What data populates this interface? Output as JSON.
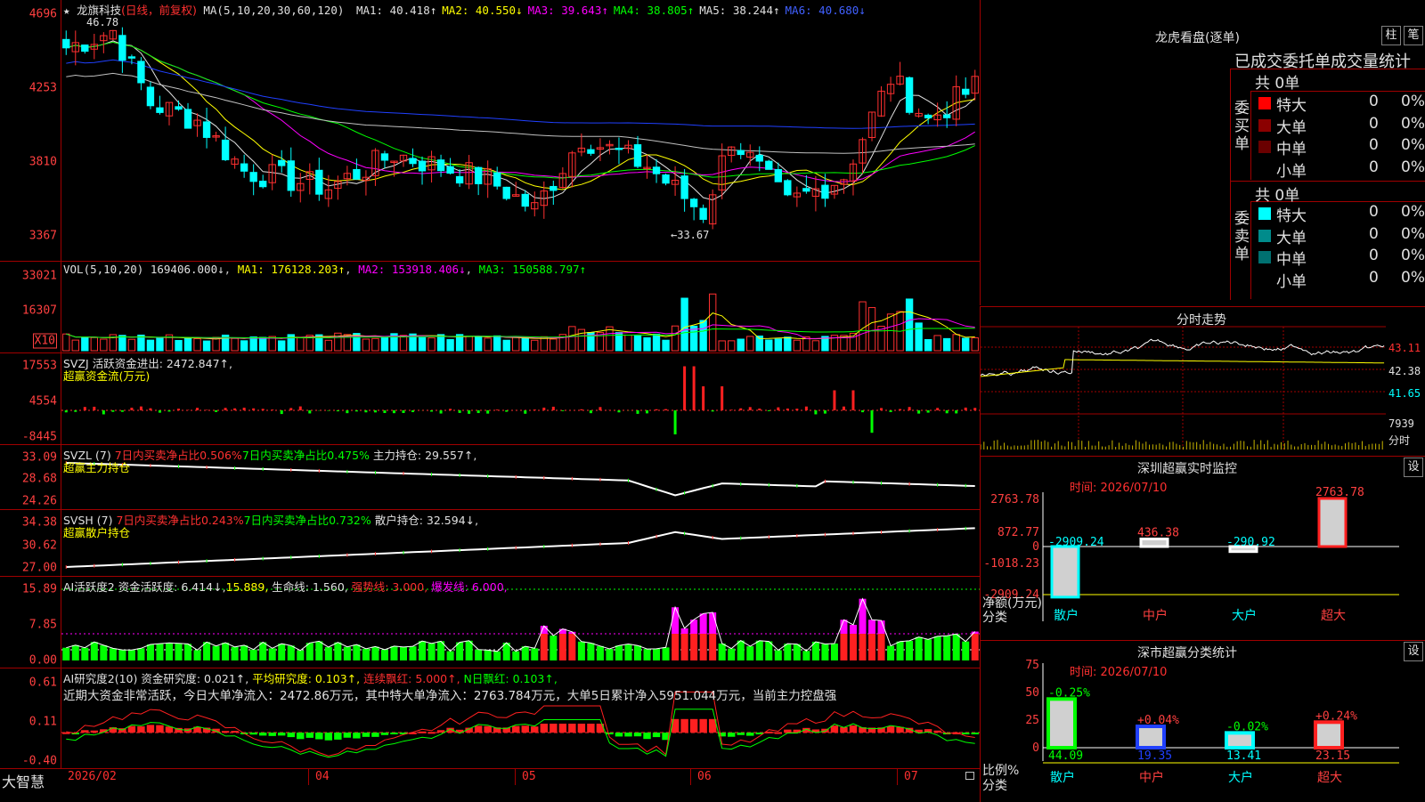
{
  "stock": {
    "name": "龙旗科技",
    "period": "(日线，前复权)",
    "star": "★"
  },
  "main": {
    "ma_title": "MA(5,10,20,30,60,120)",
    "ma": [
      {
        "t": "MA1: 40.418↑",
        "c": "#e0e0e0"
      },
      {
        "t": "MA2: 40.550↓",
        "c": "#ffff00"
      },
      {
        "t": "MA3: 39.643↑",
        "c": "#ff00ff"
      },
      {
        "t": "MA4: 38.805↑",
        "c": "#00ff00"
      },
      {
        "t": "MA5: 38.244↑",
        "c": "#e0e0e0"
      },
      {
        "t": "MA6: 40.680↓",
        "c": "#4060ff"
      }
    ],
    "yticks": [
      "4696",
      "4253",
      "3810",
      "3367"
    ],
    "high_label": "46.78",
    "low_label": "←33.67"
  },
  "vol": {
    "title": "VOL(5,10,20)",
    "v": "169406.000↓",
    "ma1": "MA1: 176128.203↑",
    "ma2": "MA2: 153918.406↓",
    "ma3": "MA3: 150588.797↑",
    "yticks": [
      "33021",
      "16307"
    ],
    "unit": "X10"
  },
  "svzj": {
    "title": "SVZJ  活跃资金进出: 2472.847↑,",
    "sub": "超赢资金流(万元)",
    "yticks": [
      "17553",
      "4554",
      "-8445"
    ]
  },
  "svzl": {
    "title": "SVZL (7)",
    "a": "7日内买卖净占比0.506%",
    "b": "7日内买卖净占比0.475%",
    "c": "主力持仓: 29.557↑,",
    "sub": "超赢主力持仓",
    "yticks": [
      "33.09",
      "28.68",
      "24.26"
    ]
  },
  "svsh": {
    "title": "SVSH (7)",
    "a": "7日内买卖净占比0.243%",
    "b": "7日内买卖净占比0.732%",
    "c": "散户持仓: 32.594↓,",
    "sub": "超赢散户持仓",
    "yticks": [
      "34.38",
      "30.62",
      "27.00"
    ]
  },
  "ai1": {
    "title": "AI活跃度2 资金活跃度: 6.414↓,",
    "v2": "15.889,",
    "life": "生命线: 1.560,",
    "strong": "强势线: 3.000,",
    "burst": "爆发线: 6.000,",
    "yticks": [
      "15.89",
      "7.85",
      "0.00"
    ]
  },
  "ai2": {
    "title": "AI研究度2(10) 资金研究度: 0.021↑,",
    "avg": "平均研究度: 0.103↑,",
    "lian": "连续飘红: 5.000↑,",
    "nday": "N日飘红: 0.103↑,",
    "comment": "近期大资金非常活跃，今日大单净流入：2472.86万元，其中特大单净流入：2763.784万元，大单5日累计净入5951.044万元，当前主力控盘强",
    "yticks": [
      "0.61",
      "0.11",
      "-0.40"
    ]
  },
  "xaxis": {
    "brand": "大智慧",
    "dates": [
      "2026/02",
      "04",
      "05",
      "06",
      "07"
    ]
  },
  "lhb": {
    "title": "龙虎看盘(逐单)",
    "btn_zhu": "柱",
    "btn_bi": "笔",
    "stats_title": "已成交委托单成交量统计",
    "buy": {
      "label": "委买单",
      "total": "共 0单",
      "rows": [
        {
          "n": "特大",
          "v": "0",
          "p": "0%",
          "c": "#ff0000"
        },
        {
          "n": "大单",
          "v": "0",
          "p": "0%",
          "c": "#8b0000"
        },
        {
          "n": "中单",
          "v": "0",
          "p": "0%",
          "c": "#6a0000"
        },
        {
          "n": "小单",
          "v": "0",
          "p": "0%",
          "c": "#000000"
        }
      ]
    },
    "sell": {
      "label": "委卖单",
      "total": "共 0单",
      "rows": [
        {
          "n": "特大",
          "v": "0",
          "p": "0%",
          "c": "#00ffff"
        },
        {
          "n": "大单",
          "v": "0",
          "p": "0%",
          "c": "#008b8b"
        },
        {
          "n": "中单",
          "v": "0",
          "p": "0%",
          "c": "#007070"
        },
        {
          "n": "小单",
          "v": "0",
          "p": "0%",
          "c": "#000000"
        }
      ]
    }
  },
  "intraday": {
    "title": "分时走势",
    "yticks": [
      "43.11",
      "42.38",
      "41.65"
    ],
    "vol_label": "7939",
    "vol_unit": "分时"
  },
  "sz_monitor": {
    "title": "深圳超赢实时监控",
    "btn": "设",
    "date": "时间: 2026/07/10",
    "yticks": [
      "2763.78",
      "872.77",
      "0",
      "-1018.23",
      "-2909.24"
    ],
    "ylabel": "净额(万元)",
    "xlabel": "分类",
    "cats": [
      "散户",
      "中户",
      "大户",
      "超大"
    ],
    "values": [
      -2909.24,
      436.38,
      -290.92,
      2763.78
    ],
    "labels": [
      "-2909.24",
      "436.38",
      "-290.92",
      "2763.78"
    ]
  },
  "sz_class": {
    "title": "深市超赢分类统计",
    "btn": "设",
    "date": "时间: 2026/07/10",
    "yticks": [
      "75",
      "50",
      "25",
      "0"
    ],
    "ylabel": "比例%",
    "xlabel": "分类",
    "cats": [
      "散户",
      "中户",
      "大户",
      "超大"
    ],
    "values": [
      44.09,
      19.35,
      13.41,
      23.15
    ],
    "changes": [
      "-0.25%",
      "+0.04%",
      "-0.02%",
      "+0.24%"
    ],
    "labels": [
      "44.09",
      "19.35",
      "13.41",
      "23.15"
    ]
  }
}
